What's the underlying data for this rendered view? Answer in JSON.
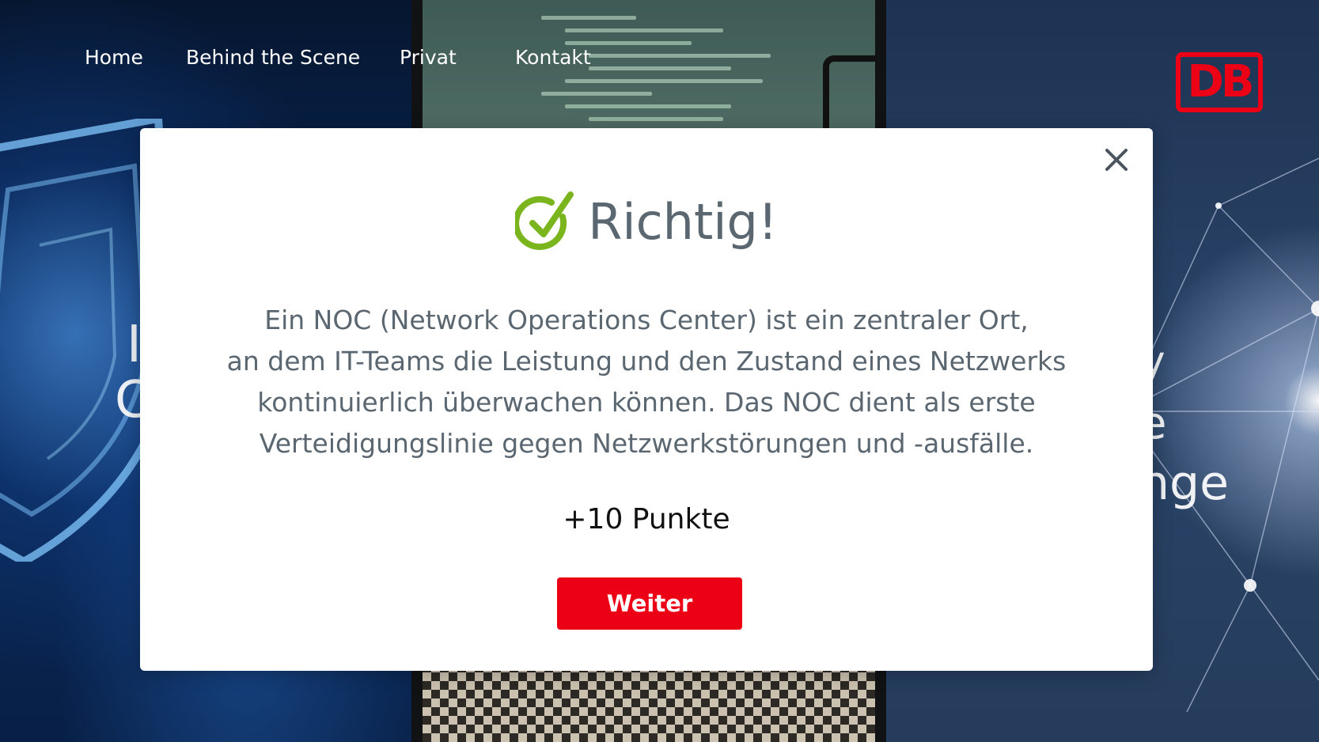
{
  "nav": {
    "items": [
      {
        "label": "Home"
      },
      {
        "label": "Behind the Scene"
      },
      {
        "label": "Privat"
      },
      {
        "label": "Kontakt"
      }
    ]
  },
  "brand": {
    "logo_text": "DB",
    "logo_color": "#ec0016"
  },
  "background": {
    "left_fragment_1": "I",
    "left_fragment_2": "C",
    "right_fragment_1": "y",
    "right_fragment_2": "e",
    "right_fragment_3": "nge"
  },
  "modal": {
    "title": "Richtig!",
    "status_icon": "check-circle-icon",
    "status_color": "#7ab51d",
    "body_lines": [
      "Ein NOC (Network Operations Center) ist ein zentraler Ort,",
      "an dem IT-Teams die Leistung und den Zustand eines Netzwerks",
      "kontinuierlich überwachen können. Das NOC dient als erste",
      "Verteidigungslinie gegen Netzwerkstörungen und -ausfälle."
    ],
    "points": "+10 Punkte",
    "continue_label": "Weiter",
    "close_icon": "close-icon",
    "button_color": "#ec0016"
  }
}
